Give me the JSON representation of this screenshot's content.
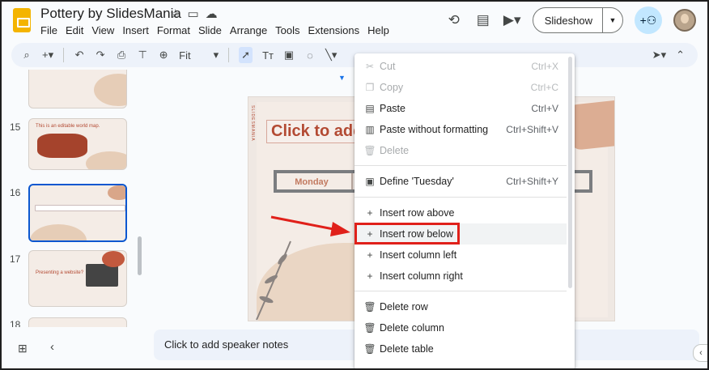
{
  "app": {
    "doc_title": "Pottery by SlidesMania",
    "menus": [
      "File",
      "Edit",
      "View",
      "Insert",
      "Format",
      "Slide",
      "Arrange",
      "Tools",
      "Extensions",
      "Help"
    ],
    "slideshow_label": "Slideshow"
  },
  "toolbar": {
    "zoom_label": "Fit"
  },
  "filmstrip": {
    "slides": [
      {
        "number": "15",
        "text": "This is an editable world map."
      },
      {
        "number": "16",
        "text": ""
      },
      {
        "number": "17",
        "text": "Presenting a website?"
      },
      {
        "number": "18",
        "text": ""
      }
    ]
  },
  "slide": {
    "title_placeholder": "Click to add",
    "table_cell": "Monday"
  },
  "notes": {
    "placeholder": "Click to add speaker notes"
  },
  "context_menu": {
    "items": [
      {
        "label": "Cut",
        "shortcut": "Ctrl+X",
        "icon": "scissors-icon",
        "disabled": true
      },
      {
        "label": "Copy",
        "shortcut": "Ctrl+C",
        "icon": "copy-icon",
        "disabled": true
      },
      {
        "label": "Paste",
        "shortcut": "Ctrl+V",
        "icon": "paste-icon",
        "disabled": false
      },
      {
        "label": "Paste without formatting",
        "shortcut": "Ctrl+Shift+V",
        "icon": "paste-plain-icon",
        "disabled": false
      },
      {
        "label": "Delete",
        "shortcut": "",
        "icon": "trash-icon",
        "disabled": true
      },
      {
        "label": "Define 'Tuesday'",
        "shortcut": "Ctrl+Shift+Y",
        "icon": "book-icon",
        "disabled": false
      },
      {
        "label": "Insert row above",
        "shortcut": "",
        "icon": "plus-icon",
        "disabled": false
      },
      {
        "label": "Insert row below",
        "shortcut": "",
        "icon": "plus-icon",
        "disabled": false
      },
      {
        "label": "Insert column left",
        "shortcut": "",
        "icon": "plus-icon",
        "disabled": false
      },
      {
        "label": "Insert column right",
        "shortcut": "",
        "icon": "plus-icon",
        "disabled": false
      },
      {
        "label": "Delete row",
        "shortcut": "",
        "icon": "trash-icon",
        "disabled": false
      },
      {
        "label": "Delete column",
        "shortcut": "",
        "icon": "trash-icon",
        "disabled": false
      },
      {
        "label": "Delete table",
        "shortcut": "",
        "icon": "trash-icon",
        "disabled": false
      }
    ],
    "highlighted": "Insert row below"
  },
  "colors": {
    "accent_blue": "#0b57d0",
    "annotation_red": "#e0201a",
    "slide_accent": "#b34a33"
  }
}
